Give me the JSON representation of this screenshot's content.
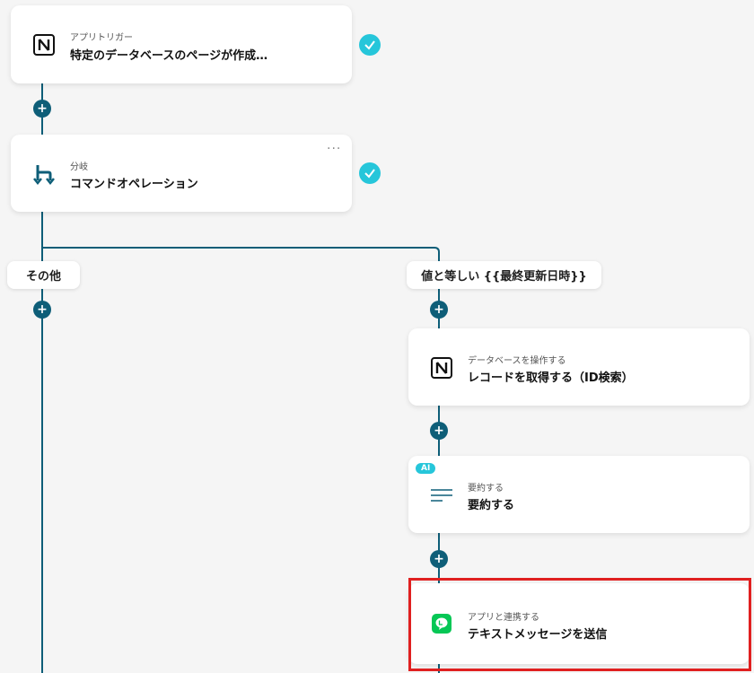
{
  "flow": {
    "trigger": {
      "sub": "アプリトリガー",
      "title": "特定のデータベースのページが作成…",
      "icon": "notion-icon"
    },
    "branch": {
      "sub": "分岐",
      "title": "コマンドオペレーション",
      "icon": "branch-icon",
      "more": "···"
    },
    "branch_labels": {
      "left": "その他",
      "right": "値と等しい {{最終更新日時}}"
    },
    "steps": [
      {
        "sub": "データベースを操作する",
        "title": "レコードを取得する（ID検索）",
        "icon": "notion-icon"
      },
      {
        "sub": "要約する",
        "title": "要約する",
        "icon": "summary-lines-icon",
        "badge": "AI"
      },
      {
        "sub": "アプリと連携する",
        "title": "テキストメッセージを送信",
        "icon": "line-app-icon"
      }
    ]
  },
  "colors": {
    "connector": "#0e5e78",
    "check": "#26c6da",
    "highlight": "#e02020",
    "line_green": "#06c755"
  }
}
